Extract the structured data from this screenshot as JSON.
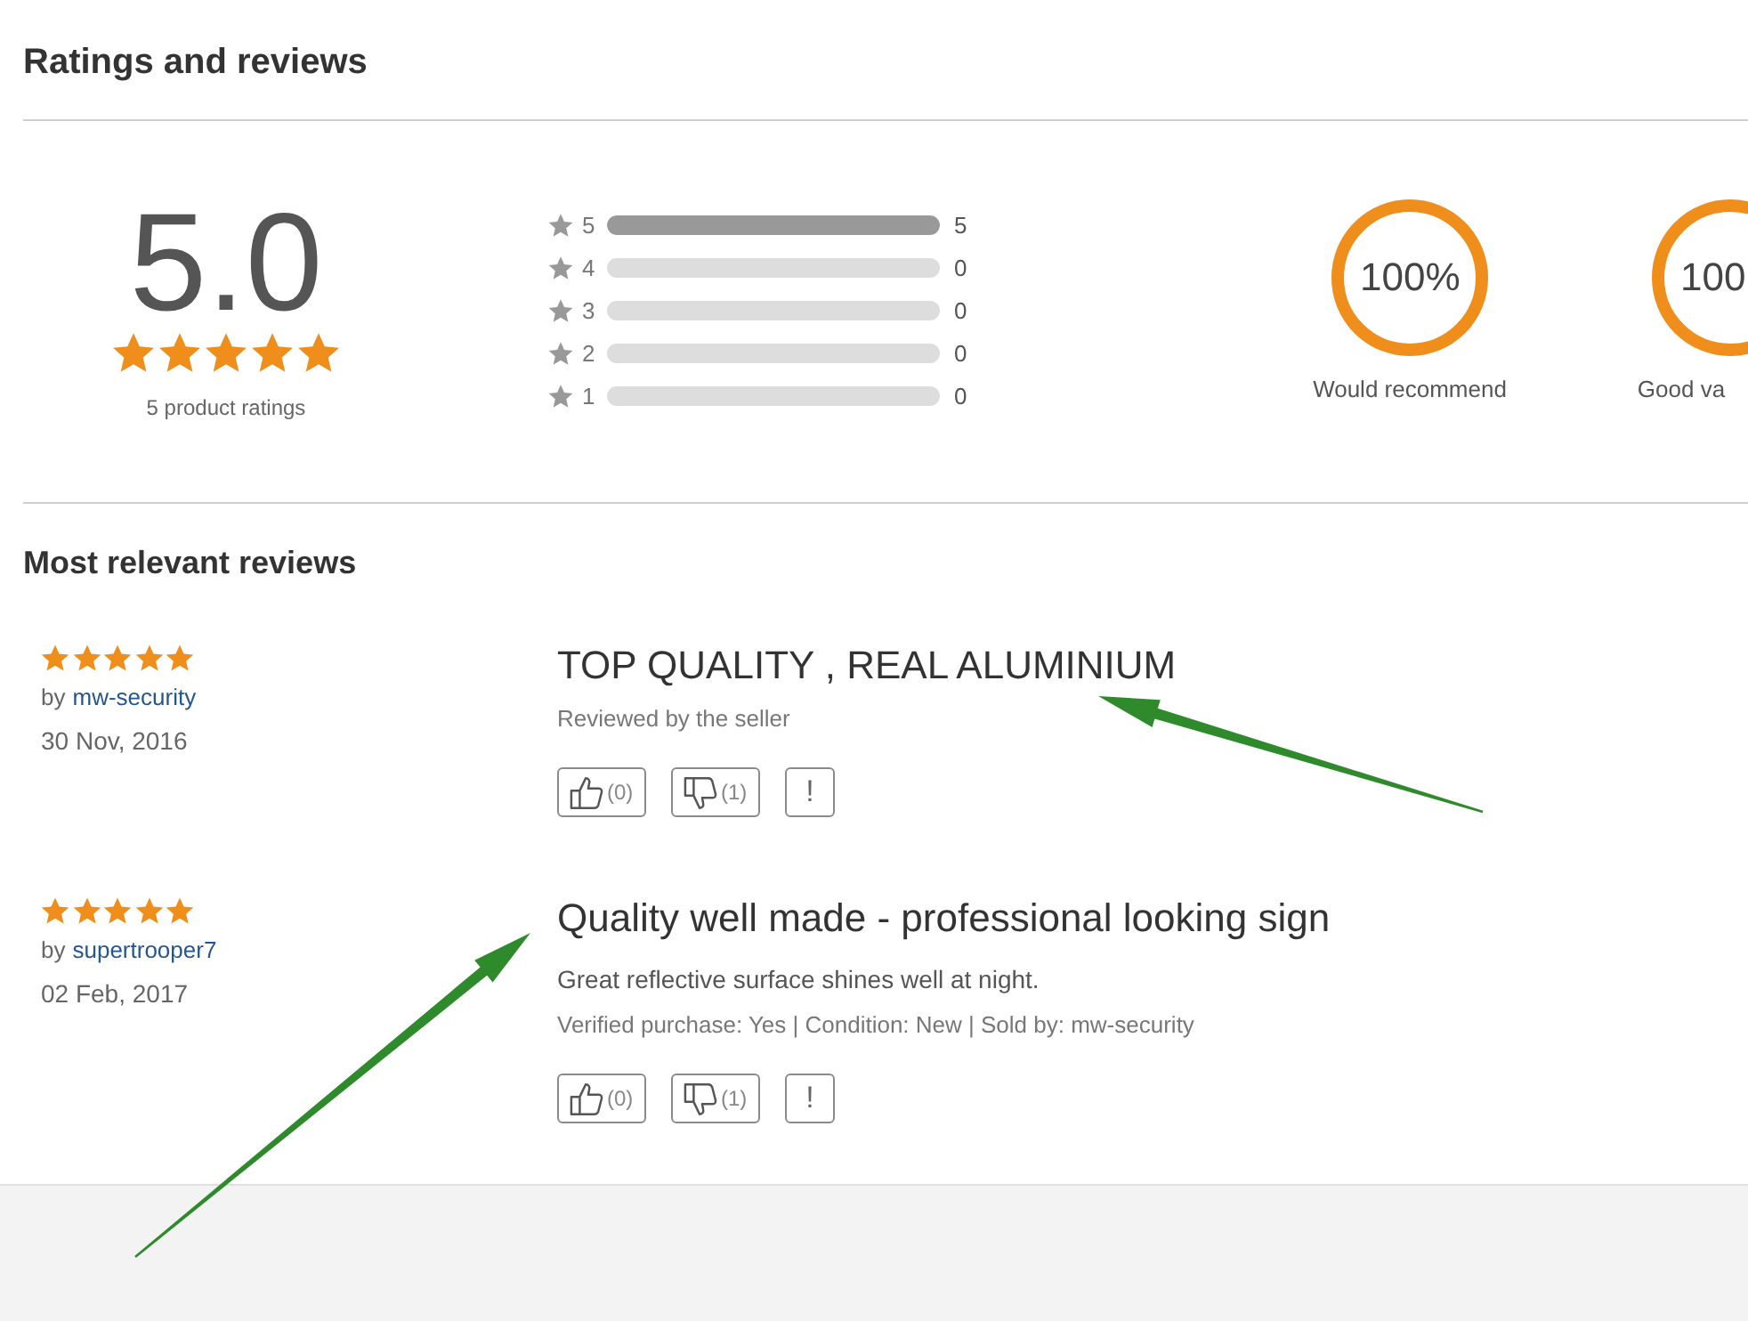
{
  "section_title": "Ratings and reviews",
  "summary": {
    "average": "5.0",
    "stars": 5,
    "count_label": "5 product ratings"
  },
  "histogram": [
    {
      "label": "5",
      "level": 1,
      "count": "5"
    },
    {
      "label": "4",
      "level": 0,
      "count": "0"
    },
    {
      "label": "3",
      "level": 0,
      "count": "0"
    },
    {
      "label": "2",
      "level": 0,
      "count": "0"
    },
    {
      "label": "1",
      "level": 0,
      "count": "0"
    }
  ],
  "metrics": [
    {
      "value": "100%",
      "level": 1,
      "label": "Would recommend"
    },
    {
      "value": "100",
      "label": "Good va"
    }
  ],
  "reviews_title": "Most relevant reviews",
  "reviews": [
    {
      "stars": 5,
      "author_prefix": "by",
      "author": "mw-security",
      "date": "30 Nov, 2016",
      "title": "TOP QUALITY , REAL ALUMINIUM",
      "meta": "Reviewed by the seller",
      "helpful_count": "(0)",
      "unhelpful_count": "(1)",
      "report": "!"
    },
    {
      "stars": 5,
      "author_prefix": "by",
      "author": "supertrooper7",
      "date": "02 Feb, 2017",
      "title": "Quality well made - professional looking sign",
      "body": "Great reflective surface shines well at night.",
      "meta": "Verified purchase: Yes | Condition: New | Sold by: mw-security",
      "helpful_count": "(0)",
      "unhelpful_count": "(1)",
      "report": "!"
    }
  ],
  "annotations": [
    {
      "kind": "arrow"
    },
    {
      "kind": "arrow"
    }
  ]
}
